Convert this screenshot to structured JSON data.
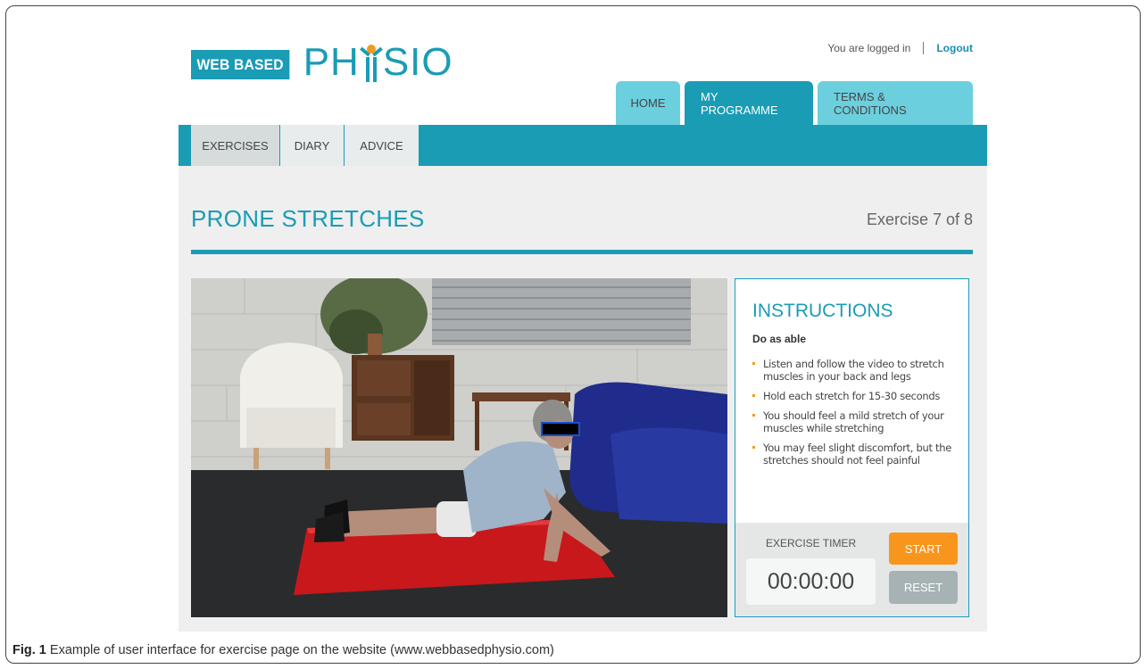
{
  "header": {
    "logo_box_text": "WEB BASED",
    "logo_word_left": "PH",
    "logo_word_right": "SIO",
    "login_status": "You are logged in",
    "logout_label": "Logout"
  },
  "top_tabs": [
    {
      "label": "HOME"
    },
    {
      "label": "MY PROGRAMME"
    },
    {
      "label": "TERMS & CONDITIONS"
    }
  ],
  "subnav": [
    {
      "label": "EXERCISES"
    },
    {
      "label": "DIARY"
    },
    {
      "label": "ADVICE"
    }
  ],
  "main": {
    "title": "PRONE STRETCHES",
    "exercise_count": "Exercise 7 of 8"
  },
  "instructions": {
    "title": "INSTRUCTIONS",
    "subtitle": "Do as able",
    "items": [
      "Listen and follow the video to stretch muscles in your back and legs",
      "Hold each stretch for 15-30 seconds",
      "You should feel a mild stretch of your muscles while stretching",
      "You may feel slight discomfort, but the stretches should not feel painful"
    ]
  },
  "timer": {
    "label": "EXERCISE TIMER",
    "value": "00:00:00",
    "start_label": "START",
    "reset_label": "RESET"
  },
  "caption": {
    "fig": "Fig. 1",
    "text": " Example of user interface for exercise page on the website (www.webbasedphysio.com)"
  },
  "colors": {
    "brand_teal": "#1a9cb5",
    "tab_light": "#6ccfde",
    "accent_orange": "#f7951d",
    "reset_grey": "#a7b2b4"
  }
}
